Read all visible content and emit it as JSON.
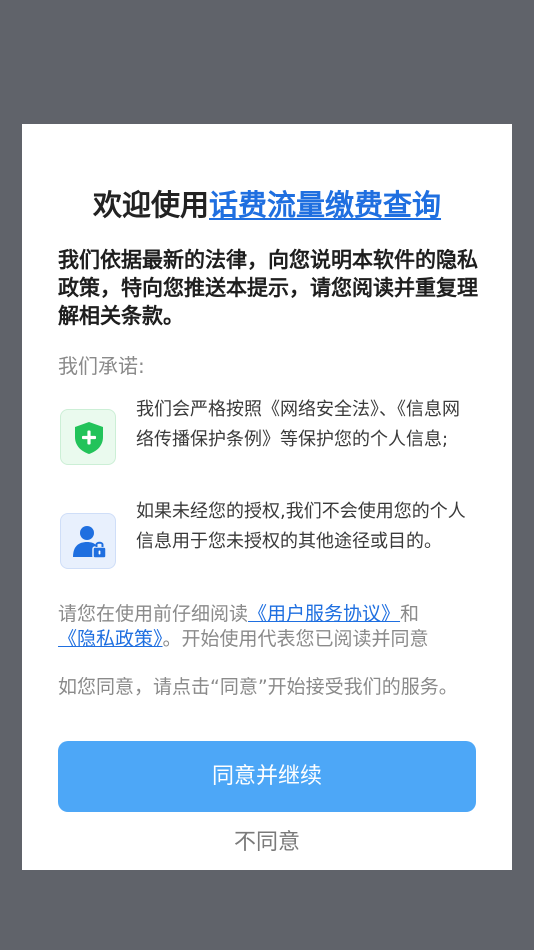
{
  "dialog": {
    "title_prefix": "欢迎使用",
    "title_app_name": "话费流量缴费查询",
    "intro": "我们依据最新的法律，向您说明本软件的隐私政策，特向您推送本提示，请您阅读并重复理解相关条款。",
    "promise_heading": "我们承诺:",
    "promises": [
      {
        "icon": "shield-plus-icon",
        "text": "我们会严格按照《网络安全法》、《信息网络传播保护条例》等保护您的个人信息;"
      },
      {
        "icon": "user-lock-icon",
        "text": "如果未经您的授权,我们不会使用您的个人信息用于您未授权的其他途径或目的。"
      }
    ],
    "notice": {
      "before": "请您在使用前仔细阅读",
      "user_agreement_link": "《用户服务协议》",
      "and": "和",
      "privacy_policy_link": "《隐私政策》",
      "after": "。开始使用代表您已阅读并同意"
    },
    "consent_text": "如您同意，请点击“同意”开始接受我们的服务。",
    "agree_button": "同意并继续",
    "disagree_button": "不同意"
  },
  "colors": {
    "overlay": "#60636a",
    "link": "#1f6fe0",
    "primary_button": "#4da7f7",
    "shield_green": "#22c35a",
    "user_blue": "#1f6fe0"
  }
}
